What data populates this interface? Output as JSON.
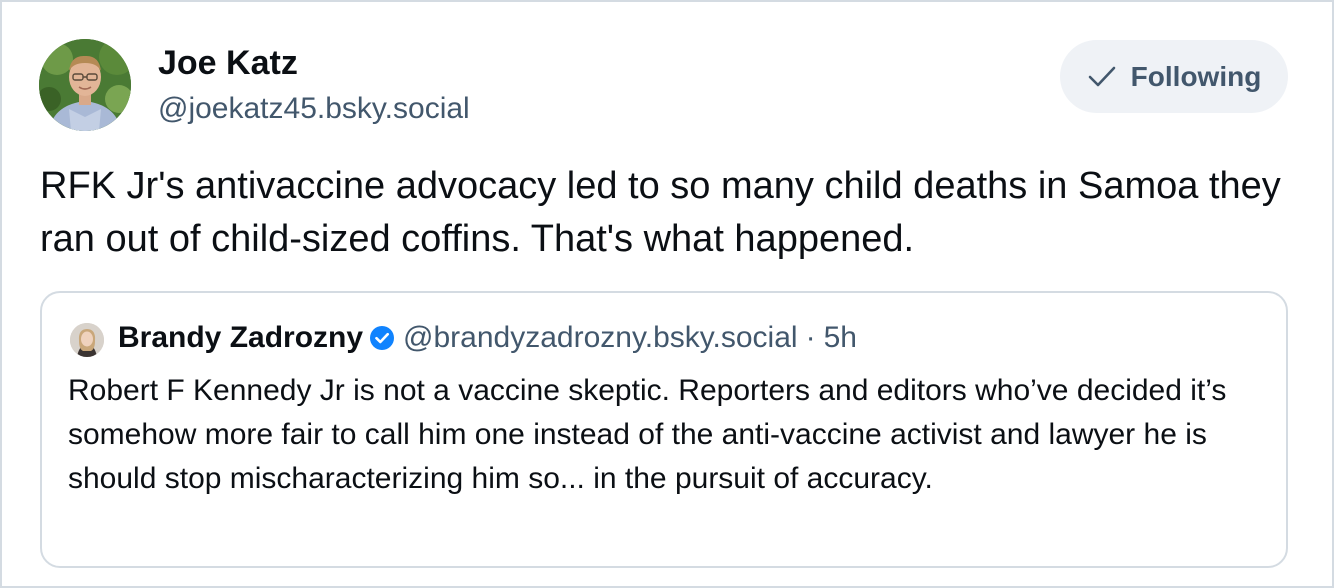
{
  "post": {
    "author": {
      "display_name": "Joe Katz",
      "handle": "@joekatz45.bsky.social",
      "avatar_icon": "profile-photo"
    },
    "follow_button": {
      "label": "Following",
      "icon": "check-icon"
    },
    "text": "RFK Jr's antivaccine advocacy led to so many child deaths in Samoa they ran out of child-sized coffins. That's what happened.",
    "quoted_post": {
      "author": {
        "display_name": "Brandy Zadrozny",
        "handle": "@brandyzadrozny.bsky.social",
        "verified": true,
        "verified_icon": "verified-badge-icon"
      },
      "separator": "·",
      "time": "5h",
      "text": "Robert F Kennedy Jr is not a vaccine skeptic. Reporters and editors who’ve decided it’s somehow more fair to call him one instead of the anti-vaccine activist and lawyer he is should stop mischaracterizing him so... in the pursuit of accuracy."
    }
  },
  "colors": {
    "primary_text": "#0b0f14",
    "secondary_text": "#42576c",
    "border": "#d4dbe2",
    "button_bg": "#eff2f6",
    "verified_blue": "#1083fe"
  }
}
